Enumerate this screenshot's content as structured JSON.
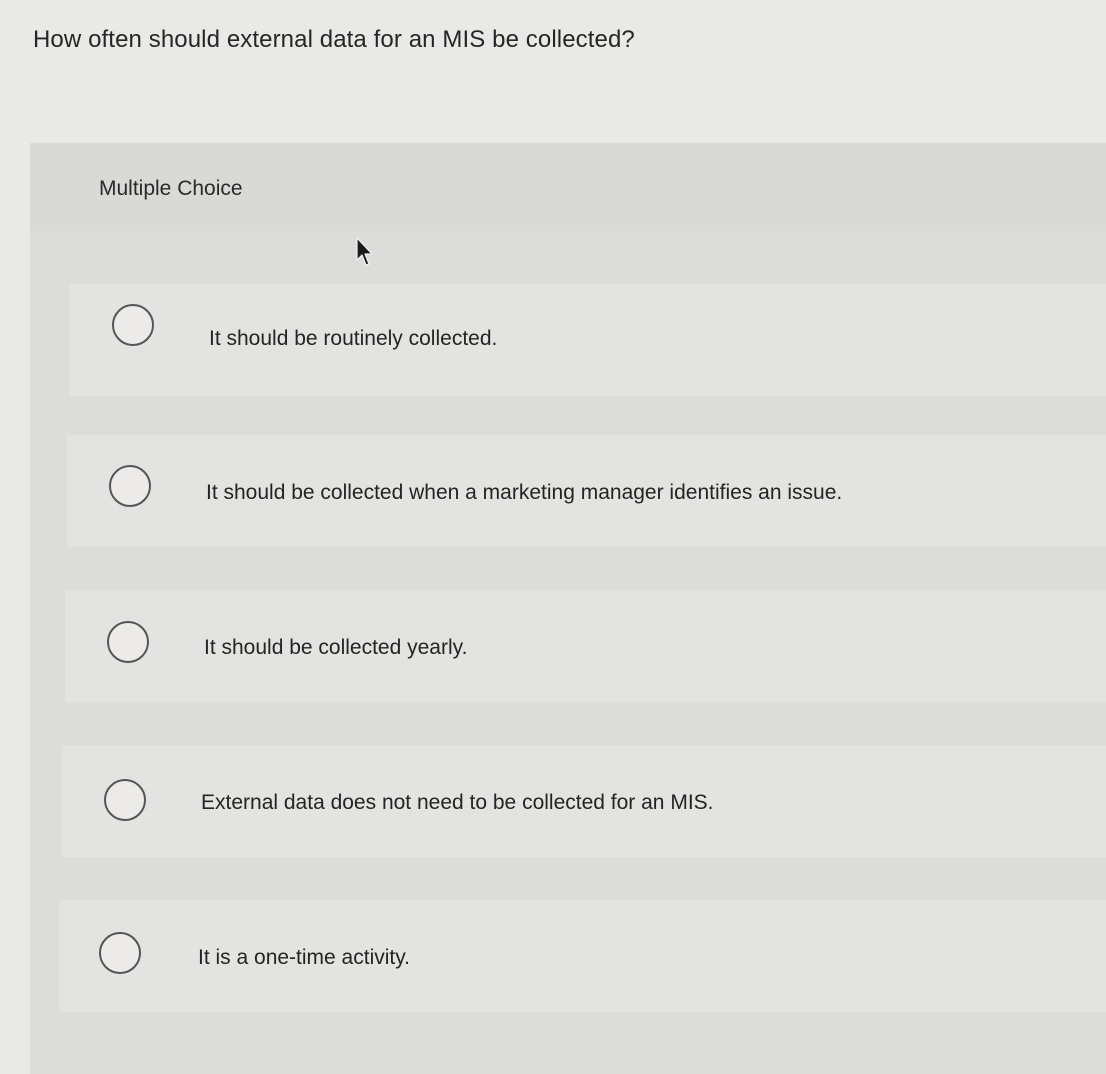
{
  "question": {
    "text": "How often should external data for an MIS be collected?"
  },
  "panel": {
    "type_label": "Multiple Choice"
  },
  "options": [
    {
      "label": "It should be routinely collected."
    },
    {
      "label": "It should be collected when a marketing manager identifies an issue."
    },
    {
      "label": "It should be collected yearly."
    },
    {
      "label": "External data does not need to be collected for an MIS."
    },
    {
      "label": "It is a one-time activity."
    }
  ],
  "colors": {
    "background": "#e9e9e7",
    "panel": "#dcdcda",
    "option_row": "#e3e3e1",
    "radio_border": "#555555",
    "text": "#262626"
  },
  "icons": {
    "cursor": "mouse-pointer-icon"
  }
}
